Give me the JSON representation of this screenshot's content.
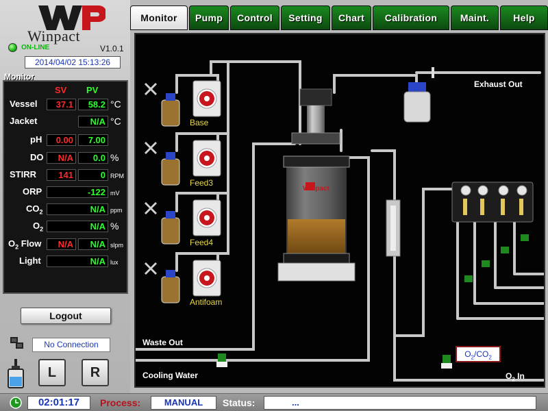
{
  "app": {
    "brand_name": "Winpact",
    "version": "V1.0.1",
    "connection_status": "ON-LINE",
    "datetime": "2014/04/02 15:13:26"
  },
  "tabs": [
    "Monitor",
    "Pump",
    "Control",
    "Setting",
    "Chart",
    "Calibration",
    "Maint.",
    "Help"
  ],
  "monitor": {
    "title": "Monitor",
    "sv_header": "SV",
    "pv_header": "PV",
    "rows": [
      {
        "label": "Vessel",
        "sv": "37.1",
        "pv": "58.2",
        "unit": "°C"
      },
      {
        "label": "Jacket",
        "pv": "N/A",
        "unit": "°C"
      },
      {
        "label": "pH",
        "sv": "0.00",
        "pv": "7.00",
        "unit": ""
      },
      {
        "label": "DO",
        "sv": "N/A",
        "pv": "0.0",
        "unit": "%"
      },
      {
        "label": "STIRR",
        "sv": "141",
        "pv": "0",
        "unit": "RPM"
      },
      {
        "label": "ORP",
        "pv": "-122",
        "unit": "mV"
      },
      {
        "label": "CO",
        "label_sub": "2",
        "pv": "N/A",
        "unit": "ppm"
      },
      {
        "label": "O",
        "label_sub": "2",
        "pv": "N/A",
        "unit": "%"
      },
      {
        "label_prefix": "O",
        "label_sub": "2",
        "label": " Flow",
        "sv": "N/A",
        "pv": "N/A",
        "unit": "slpm"
      },
      {
        "label": "Light",
        "pv": "N/A",
        "unit": "lux"
      }
    ]
  },
  "controls": {
    "logout_label": "Logout",
    "connection_text": "No Connection",
    "left_button": "L",
    "right_button": "R"
  },
  "status_bar": {
    "timer": "02:01:17",
    "process_label": "Process:",
    "process_value": "MANUAL",
    "status_label": "Status:",
    "status_value": "..."
  },
  "diagram": {
    "exhaust_out": "Exhaust Out",
    "waste_out": "Waste Out",
    "cooling_water": "Cooling Water",
    "o2_in": "O",
    "o2_in_sub": "2",
    "o2_in_suffix": " In",
    "vessel_brand": "Winpact",
    "pumps": [
      "Base",
      "Feed3",
      "Feed4",
      "Antifoam"
    ],
    "gas_button": {
      "a": "O",
      "a_sub": "2",
      "sep": "/CO",
      "b_sub": "2"
    }
  },
  "colors": {
    "tab_active_bg": "#ffffff",
    "tab_bg": "#17801c",
    "sv_color": "#ff2a2a",
    "pv_color": "#2dff2d",
    "pump_label": "#e8d84a",
    "process_label": "#b5141d",
    "value_blue": "#1a35b5"
  }
}
